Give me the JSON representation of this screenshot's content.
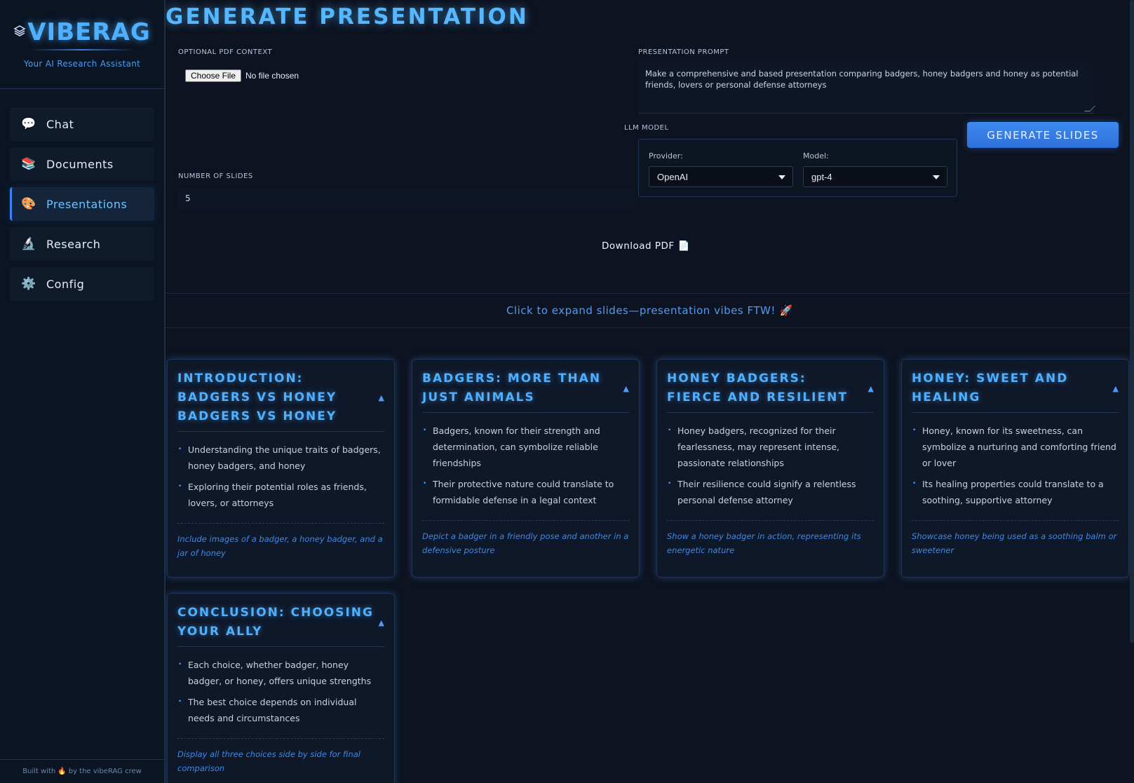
{
  "sidebar": {
    "logo_icon": "layers-icon",
    "brand": "VIBERAG",
    "tagline": "Your AI Research Assistant",
    "items": [
      {
        "label": "Chat",
        "icon": "💬",
        "icon_name": "speech-bubble-icon",
        "active": false
      },
      {
        "label": "Documents",
        "icon": "📚",
        "icon_name": "books-icon",
        "active": false
      },
      {
        "label": "Presentations",
        "icon": "🎨",
        "icon_name": "palette-icon",
        "active": true
      },
      {
        "label": "Research",
        "icon": "🔬",
        "icon_name": "microscope-icon",
        "active": false
      },
      {
        "label": "Config",
        "icon": "⚙️",
        "icon_name": "gear-icon",
        "active": false
      }
    ],
    "footer_prefix": "Built with",
    "footer_icon": "🔥",
    "footer_suffix": "by the vibeRAG crew"
  },
  "main": {
    "title": "GENERATE PRESENTATION",
    "pdf_label": "OPTIONAL PDF CONTEXT",
    "file_button": "Choose File",
    "file_status": "No file chosen",
    "prompt_label": "PRESENTATION PROMPT",
    "prompt_value": "Make a comprehensive and based presentation comparing badgers, honey badgers and honey as potential friends, lovers or personal defense attorneys",
    "slides_label": "NUMBER OF SLIDES",
    "slides_value": "5",
    "llm_label": "LLM MODEL",
    "provider_label": "Provider:",
    "provider_value": "OpenAI",
    "model_label": "Model:",
    "model_value": "gpt-4",
    "generate_button": "GENERATE SLIDES",
    "download_label": "Download PDF",
    "download_icon": "📄",
    "banner_text": "Click to expand slides—presentation vibes FTW!",
    "banner_icon": "🚀"
  },
  "slides": [
    {
      "title": "INTRODUCTION: BADGERS VS HONEY BADGERS VS HONEY",
      "bullets": [
        "Understanding the unique traits of badgers, honey badgers, and honey",
        "Exploring their potential roles as friends, lovers, or attorneys"
      ],
      "note": "Include images of a badger, a honey badger, and a jar of honey"
    },
    {
      "title": "BADGERS: MORE THAN JUST ANIMALS",
      "bullets": [
        "Badgers, known for their strength and determination, can symbolize reliable friendships",
        "Their protective nature could translate to formidable defense in a legal context"
      ],
      "note": "Depict a badger in a friendly pose and another in a defensive posture"
    },
    {
      "title": "HONEY BADGERS: FIERCE AND RESILIENT",
      "bullets": [
        "Honey badgers, recognized for their fearlessness, may represent intense, passionate relationships",
        "Their resilience could signify a relentless personal defense attorney"
      ],
      "note": "Show a honey badger in action, representing its energetic nature"
    },
    {
      "title": "HONEY: SWEET AND HEALING",
      "bullets": [
        "Honey, known for its sweetness, can symbolize a nurturing and comforting friend or lover",
        "Its healing properties could translate to a soothing, supportive attorney"
      ],
      "note": "Showcase honey being used as a soothing balm or sweetener"
    },
    {
      "title": "CONCLUSION: CHOOSING YOUR ALLY",
      "bullets": [
        "Each choice, whether badger, honey badger, or honey, offers unique strengths",
        "The best choice depends on individual needs and circumstances"
      ],
      "note": "Display all three choices side by side for final comparison"
    }
  ],
  "toggle_symbol": "▲",
  "colors": {
    "accent": "#4fb0ff",
    "button": "#3d8bf2",
    "background": "#0d1320"
  }
}
